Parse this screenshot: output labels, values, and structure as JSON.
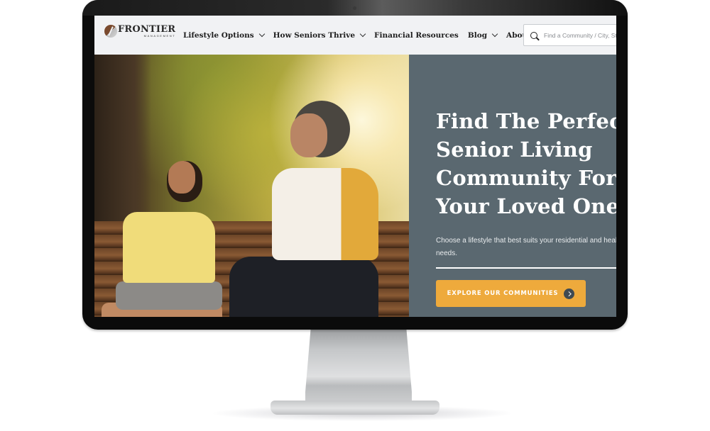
{
  "device": {
    "type": "desktop-monitor-mockup"
  },
  "header": {
    "logo": {
      "name": "FRONTIER",
      "tagline": "MANAGEMENT"
    },
    "nav": [
      {
        "label": "Lifestyle Options",
        "has_dropdown": true
      },
      {
        "label": "How Seniors Thrive",
        "has_dropdown": true
      },
      {
        "label": "Financial Resources",
        "has_dropdown": false
      },
      {
        "label": "Blog",
        "has_dropdown": true
      },
      {
        "label": "About Us",
        "has_dropdown": true
      }
    ],
    "search": {
      "icon": "search-icon",
      "placeholder": "Find a Community / City, State",
      "value": ""
    }
  },
  "hero": {
    "image": {
      "description": "Boy and grandmother laughing together on a wooden park bench"
    },
    "headline_lines": [
      "Find The Perfect",
      "Senior Living",
      "Community For",
      "Your Loved One"
    ],
    "subtext": "Choose a lifestyle that best suits your residential and health needs.",
    "cta": {
      "label": "EXPLORE OUR COMMUNITIES",
      "icon": "chevron-right-circle-icon"
    }
  },
  "colors": {
    "panel": "#5a6870",
    "cta": "#eeaa3c",
    "header_bg": "#f1f2f4",
    "cta_icon_bg": "#3f4a52"
  }
}
